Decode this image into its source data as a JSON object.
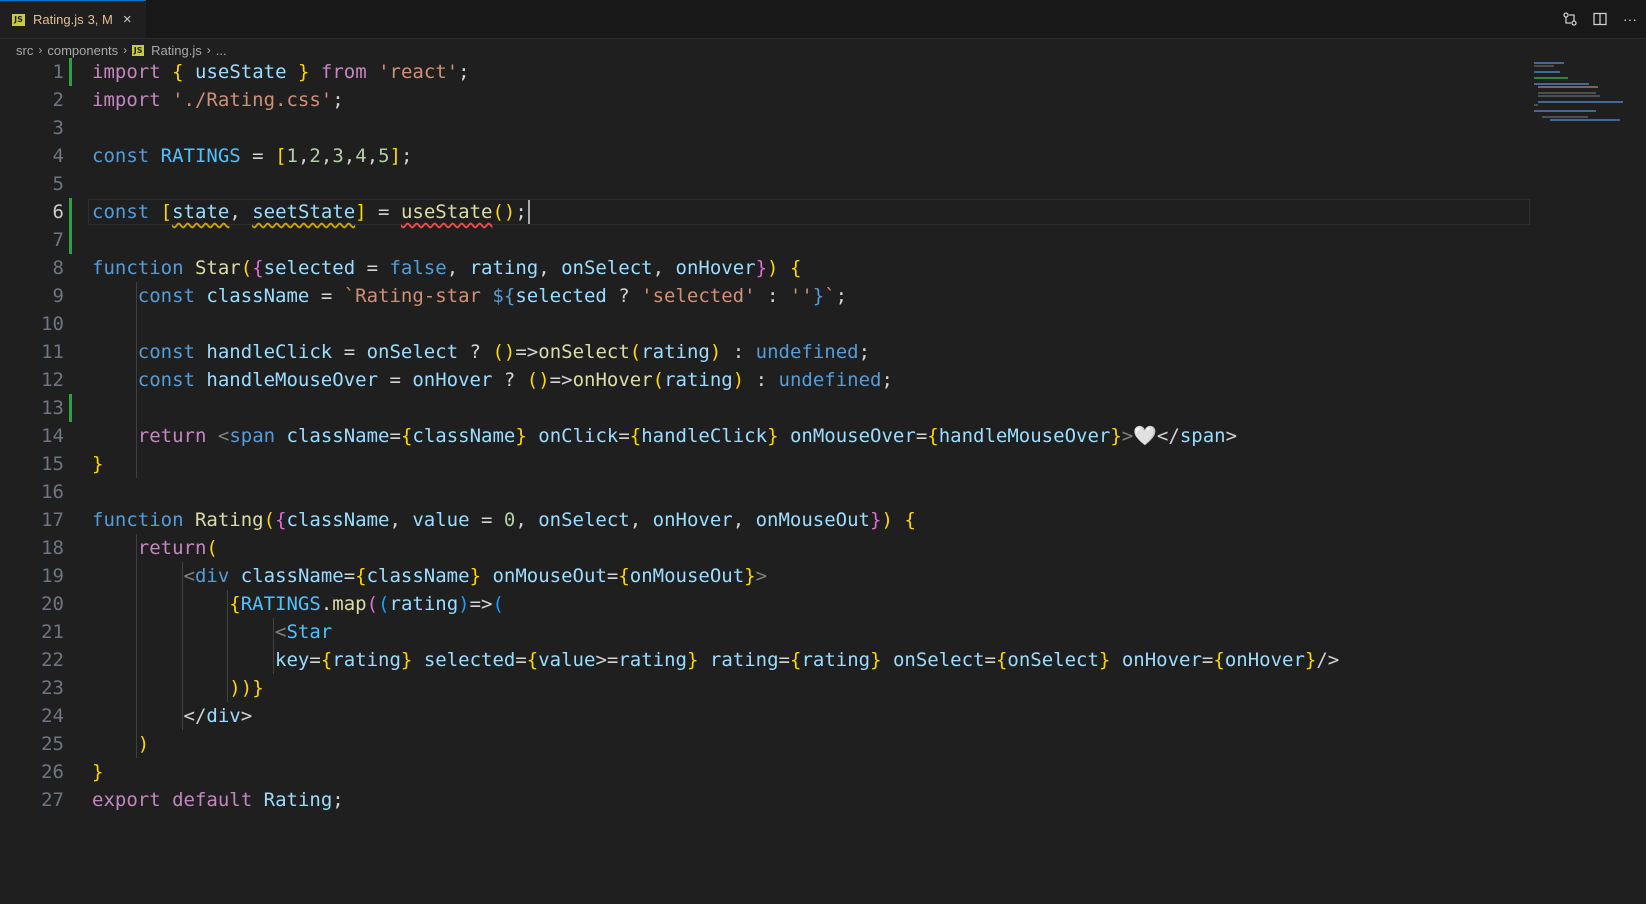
{
  "tab": {
    "filename": "Rating.js",
    "status": "3, M",
    "close": "×",
    "icon": "js-file-icon"
  },
  "title_actions": [
    {
      "name": "compare-changes-icon"
    },
    {
      "name": "split-editor-icon"
    },
    {
      "name": "more-actions-icon",
      "glyph": "···"
    }
  ],
  "breadcrumb": {
    "items": [
      "src",
      "components",
      "Rating.js",
      "..."
    ],
    "separator": "›"
  },
  "editor": {
    "active_line": 6,
    "lines": [
      {
        "n": "1",
        "text": "import { useState } from 'react';",
        "modified": true
      },
      {
        "n": "2",
        "text": "import './Rating.css';"
      },
      {
        "n": "3",
        "text": ""
      },
      {
        "n": "4",
        "text": "const RATINGS = [1,2,3,4,5];"
      },
      {
        "n": "5",
        "text": ""
      },
      {
        "n": "6",
        "text": "const [state, seetState] = useState();",
        "modified": true
      },
      {
        "n": "7",
        "text": "",
        "modified": true
      },
      {
        "n": "8",
        "text": "function Star({selected = false, rating, onSelect, onHover}) {"
      },
      {
        "n": "9",
        "text": "    const className = `Rating-star ${selected ? 'selected' : ''}`;"
      },
      {
        "n": "10",
        "text": ""
      },
      {
        "n": "11",
        "text": "    const handleClick = onSelect ? ()=>onSelect(rating) : undefined;"
      },
      {
        "n": "12",
        "text": "    const handleMouseOver = onHover ? ()=>onHover(rating) : undefined;"
      },
      {
        "n": "13",
        "text": "",
        "modified": true
      },
      {
        "n": "14",
        "text": "    return <span className={className} onClick={handleClick} onMouseOver={handleMouseOver}>🤍</span>"
      },
      {
        "n": "15",
        "text": "}"
      },
      {
        "n": "16",
        "text": ""
      },
      {
        "n": "17",
        "text": "function Rating({className, value = 0, onSelect, onHover, onMouseOut}) {"
      },
      {
        "n": "18",
        "text": "    return("
      },
      {
        "n": "19",
        "text": "        <div className={className} onMouseOut={onMouseOut}>"
      },
      {
        "n": "20",
        "text": "            {RATINGS.map((rating)=>("
      },
      {
        "n": "21",
        "text": "                <Star"
      },
      {
        "n": "22",
        "text": "                key={rating} selected={value>=rating} rating={rating} onSelect={onSelect} onHover={onHover}/>"
      },
      {
        "n": "23",
        "text": "            ))}"
      },
      {
        "n": "24",
        "text": "        </div>"
      },
      {
        "n": "25",
        "text": "    )"
      },
      {
        "n": "26",
        "text": "}"
      },
      {
        "n": "27",
        "text": "export default Rating;"
      }
    ]
  },
  "colors": {
    "background": "#1f1f1f",
    "tab_modified": "#e2c08d",
    "gutter_modified": "#2ea043",
    "keyword": "#569cd6",
    "control": "#c586c0",
    "string": "#ce9178",
    "variable": "#9cdcfe",
    "function": "#dcdcaa"
  }
}
